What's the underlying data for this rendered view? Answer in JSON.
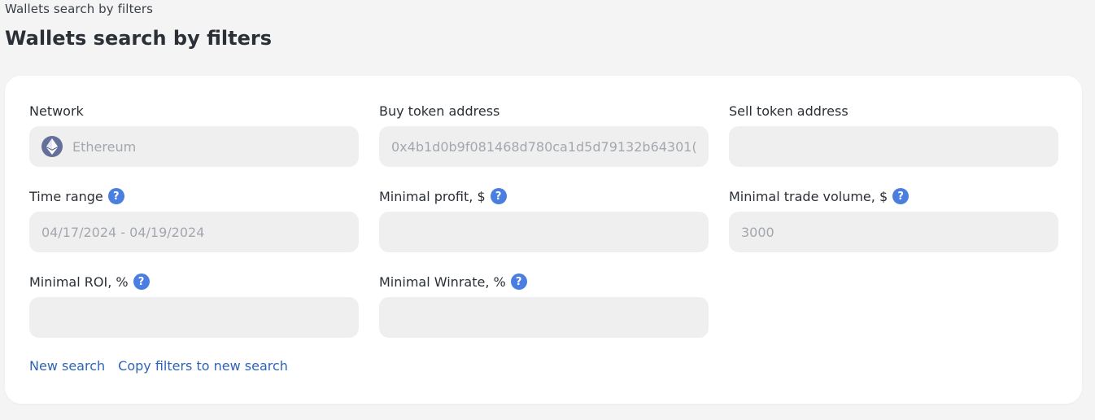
{
  "breadcrumb": "Wallets search by filters",
  "title": "Wallets search by filters",
  "fields": {
    "network": {
      "label": "Network",
      "value": "Ethereum",
      "icon": "ethereum-icon"
    },
    "buy_token": {
      "label": "Buy token address",
      "value": "0x4b1d0b9f081468d780ca1d5d79132b64301("
    },
    "sell_token": {
      "label": "Sell token address",
      "value": ""
    },
    "time_range": {
      "label": "Time range",
      "value": "04/17/2024 - 04/19/2024",
      "help": "?"
    },
    "min_profit": {
      "label": "Minimal profit, $",
      "value": "",
      "help": "?"
    },
    "min_trade_volume": {
      "label": "Minimal trade volume, $",
      "value": "3000",
      "help": "?"
    },
    "min_roi": {
      "label": "Minimal ROI, %",
      "value": "",
      "help": "?"
    },
    "min_winrate": {
      "label": "Minimal Winrate, %",
      "value": "",
      "help": "?"
    }
  },
  "actions": {
    "new_search": "New search",
    "copy_filters": "Copy filters to new search"
  },
  "colors": {
    "accent": "#4a7fe0",
    "link": "#2f63b8",
    "input_bg": "#efefef",
    "page_bg": "#f4f4f4"
  }
}
